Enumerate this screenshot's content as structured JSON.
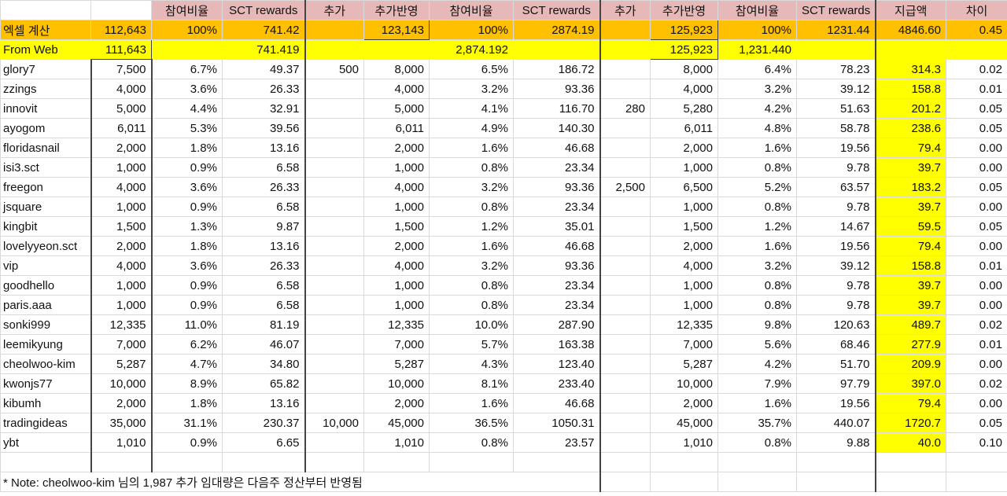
{
  "headers": [
    "",
    "",
    "참여비율",
    "SCT rewards",
    "추가",
    "추가반영",
    "참여비율",
    "SCT rewards",
    "추가",
    "추가반영",
    "참여비율",
    "SCT rewards",
    "지급액",
    "차이"
  ],
  "excel_calc": [
    "엑셀 계산",
    "112,643",
    "100%",
    "741.42",
    "",
    "123,143",
    "100%",
    "2874.19",
    "",
    "125,923",
    "100%",
    "1231.44",
    "4846.60",
    "0.45"
  ],
  "from_web": {
    "label": "From Web",
    "total": "111,643",
    "sct1": "741.419",
    "sct2": "2,874.192",
    "stake3": "125,923",
    "sct3": "1,231.440"
  },
  "rows": [
    [
      "glory7",
      "7,500",
      "6.7%",
      "49.37",
      "500",
      "8,000",
      "6.5%",
      "186.72",
      "",
      "8,000",
      "6.4%",
      "78.23",
      "314.3",
      "0.02"
    ],
    [
      "zzings",
      "4,000",
      "3.6%",
      "26.33",
      "",
      "4,000",
      "3.2%",
      "93.36",
      "",
      "4,000",
      "3.2%",
      "39.12",
      "158.8",
      "0.01"
    ],
    [
      "innovit",
      "5,000",
      "4.4%",
      "32.91",
      "",
      "5,000",
      "4.1%",
      "116.70",
      "280",
      "5,280",
      "4.2%",
      "51.63",
      "201.2",
      "0.05"
    ],
    [
      "ayogom",
      "6,011",
      "5.3%",
      "39.56",
      "",
      "6,011",
      "4.9%",
      "140.30",
      "",
      "6,011",
      "4.8%",
      "58.78",
      "238.6",
      "0.05"
    ],
    [
      "floridasnail",
      "2,000",
      "1.8%",
      "13.16",
      "",
      "2,000",
      "1.6%",
      "46.68",
      "",
      "2,000",
      "1.6%",
      "19.56",
      "79.4",
      "0.00"
    ],
    [
      "isi3.sct",
      "1,000",
      "0.9%",
      "6.58",
      "",
      "1,000",
      "0.8%",
      "23.34",
      "",
      "1,000",
      "0.8%",
      "9.78",
      "39.7",
      "0.00"
    ],
    [
      "freegon",
      "4,000",
      "3.6%",
      "26.33",
      "",
      "4,000",
      "3.2%",
      "93.36",
      "2,500",
      "6,500",
      "5.2%",
      "63.57",
      "183.2",
      "0.05"
    ],
    [
      "jsquare",
      "1,000",
      "0.9%",
      "6.58",
      "",
      "1,000",
      "0.8%",
      "23.34",
      "",
      "1,000",
      "0.8%",
      "9.78",
      "39.7",
      "0.00"
    ],
    [
      "kingbit",
      "1,500",
      "1.3%",
      "9.87",
      "",
      "1,500",
      "1.2%",
      "35.01",
      "",
      "1,500",
      "1.2%",
      "14.67",
      "59.5",
      "0.05"
    ],
    [
      "lovelyyeon.sct",
      "2,000",
      "1.8%",
      "13.16",
      "",
      "2,000",
      "1.6%",
      "46.68",
      "",
      "2,000",
      "1.6%",
      "19.56",
      "79.4",
      "0.00"
    ],
    [
      "vip",
      "4,000",
      "3.6%",
      "26.33",
      "",
      "4,000",
      "3.2%",
      "93.36",
      "",
      "4,000",
      "3.2%",
      "39.12",
      "158.8",
      "0.01"
    ],
    [
      "goodhello",
      "1,000",
      "0.9%",
      "6.58",
      "",
      "1,000",
      "0.8%",
      "23.34",
      "",
      "1,000",
      "0.8%",
      "9.78",
      "39.7",
      "0.00"
    ],
    [
      "paris.aaa",
      "1,000",
      "0.9%",
      "6.58",
      "",
      "1,000",
      "0.8%",
      "23.34",
      "",
      "1,000",
      "0.8%",
      "9.78",
      "39.7",
      "0.00"
    ],
    [
      "sonki999",
      "12,335",
      "11.0%",
      "81.19",
      "",
      "12,335",
      "10.0%",
      "287.90",
      "",
      "12,335",
      "9.8%",
      "120.63",
      "489.7",
      "0.02"
    ],
    [
      "leemikyung",
      "7,000",
      "6.2%",
      "46.07",
      "",
      "7,000",
      "5.7%",
      "163.38",
      "",
      "7,000",
      "5.6%",
      "68.46",
      "277.9",
      "0.01"
    ],
    [
      "cheolwoo-kim",
      "5,287",
      "4.7%",
      "34.80",
      "",
      "5,287",
      "4.3%",
      "123.40",
      "",
      "5,287",
      "4.2%",
      "51.70",
      "209.9",
      "0.00"
    ],
    [
      "kwonjs77",
      "10,000",
      "8.9%",
      "65.82",
      "",
      "10,000",
      "8.1%",
      "233.40",
      "",
      "10,000",
      "7.9%",
      "97.79",
      "397.0",
      "0.02"
    ],
    [
      "kibumh",
      "2,000",
      "1.8%",
      "13.16",
      "",
      "2,000",
      "1.6%",
      "46.68",
      "",
      "2,000",
      "1.6%",
      "19.56",
      "79.4",
      "0.00"
    ],
    [
      "tradingideas",
      "35,000",
      "31.1%",
      "230.37",
      "10,000",
      "45,000",
      "36.5%",
      "1050.31",
      "",
      "45,000",
      "35.7%",
      "440.07",
      "1720.7",
      "0.05"
    ],
    [
      "ybt",
      "1,010",
      "0.9%",
      "6.65",
      "",
      "1,010",
      "0.8%",
      "23.57",
      "",
      "1,010",
      "0.8%",
      "9.88",
      "40.0",
      "0.10"
    ]
  ],
  "note": "* Note: cheolwoo-kim 님의 1,987 추가 임대량은 다음주 정산부터 반영됨",
  "colors": {
    "header": "#e6b8b7",
    "calc_row": "#ffc000",
    "highlight": "#ffff00"
  }
}
